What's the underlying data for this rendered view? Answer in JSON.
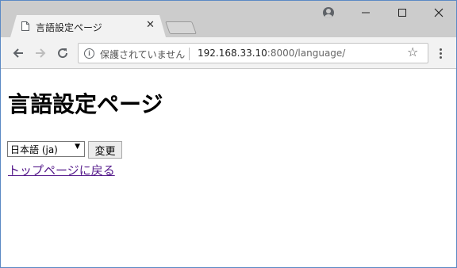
{
  "tab": {
    "title": "言語設定ページ",
    "close": "✕"
  },
  "window_controls": {
    "minimize": "—",
    "maximize": "☐",
    "close": "✕"
  },
  "toolbar": {
    "back": "←",
    "forward": "→",
    "reload": "↻",
    "info": "i",
    "security_label": "保護されていません",
    "url_host": "192.168.33.10",
    "url_rest": ":8000/language/",
    "star": "☆"
  },
  "page": {
    "heading": "言語設定ページ",
    "language_select_value": "日本語 (ja)",
    "change_button_label": "変更",
    "top_link_text": "トップページに戻る"
  }
}
